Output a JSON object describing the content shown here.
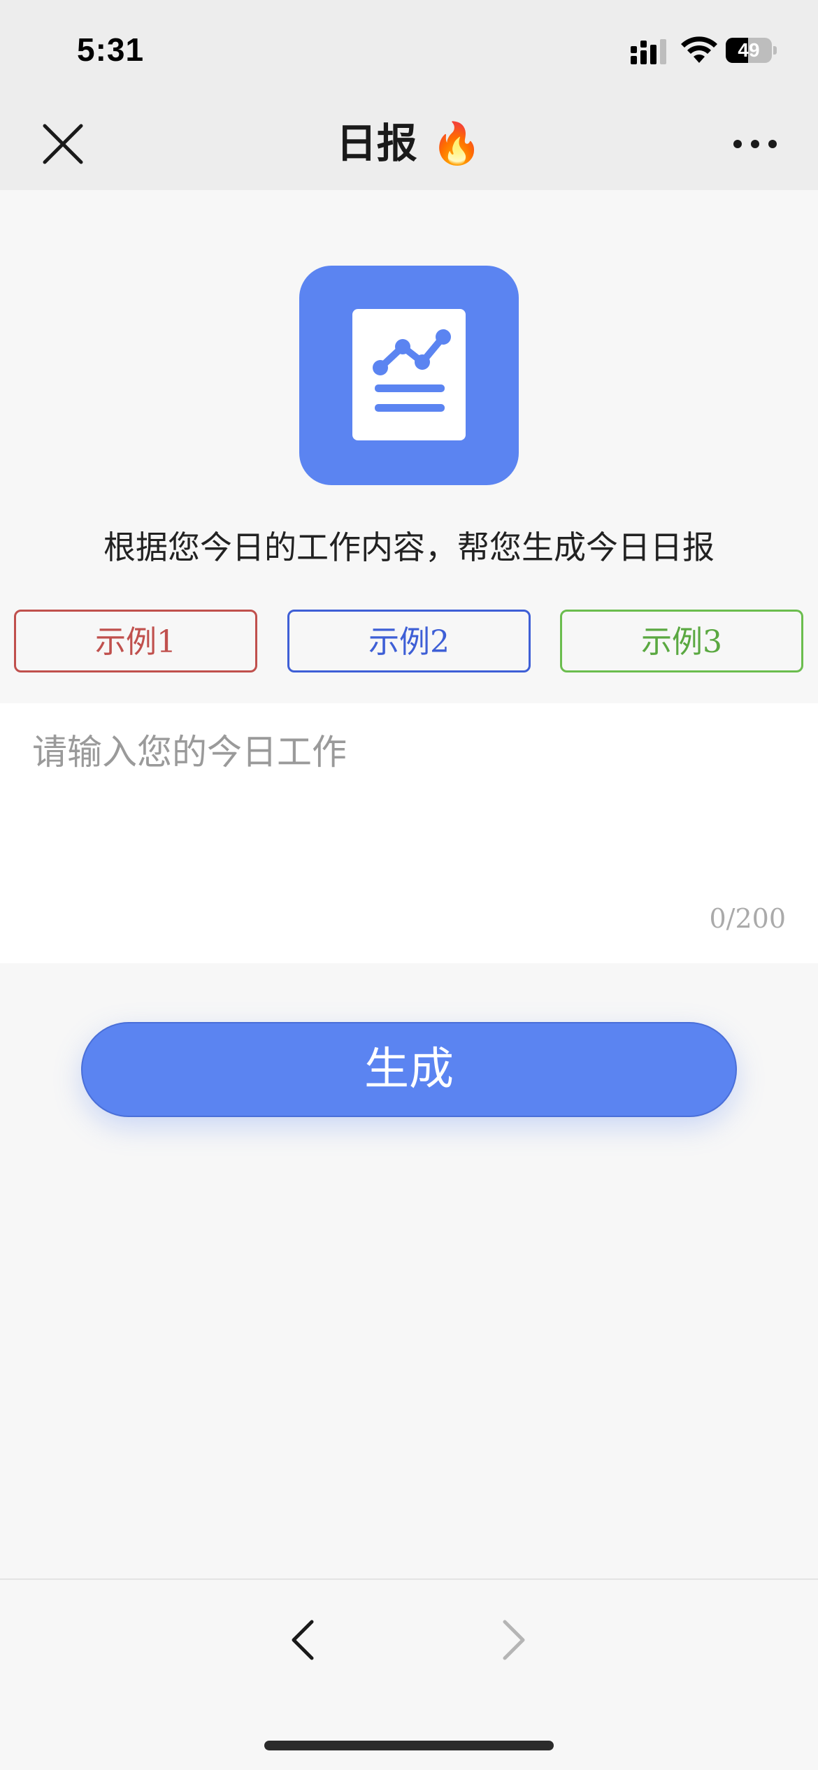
{
  "status_bar": {
    "time": "5:31",
    "battery_level": "49"
  },
  "nav": {
    "title": "日报 🔥"
  },
  "hero": {
    "icon": "report-chart-icon",
    "subtitle": "根据您今日的工作内容，帮您生成今日日报"
  },
  "examples": [
    {
      "label": "示例1",
      "color": "#c0504d"
    },
    {
      "label": "示例2",
      "color": "#3e5fd6"
    },
    {
      "label": "示例3",
      "color": "#5aa841"
    }
  ],
  "input": {
    "value": "",
    "placeholder": "请输入您的今日工作",
    "counter": "0/200"
  },
  "generate": {
    "label": "生成"
  },
  "colors": {
    "accent": "#5b84f1",
    "background": "#f7f7f7",
    "header": "#ededed"
  }
}
